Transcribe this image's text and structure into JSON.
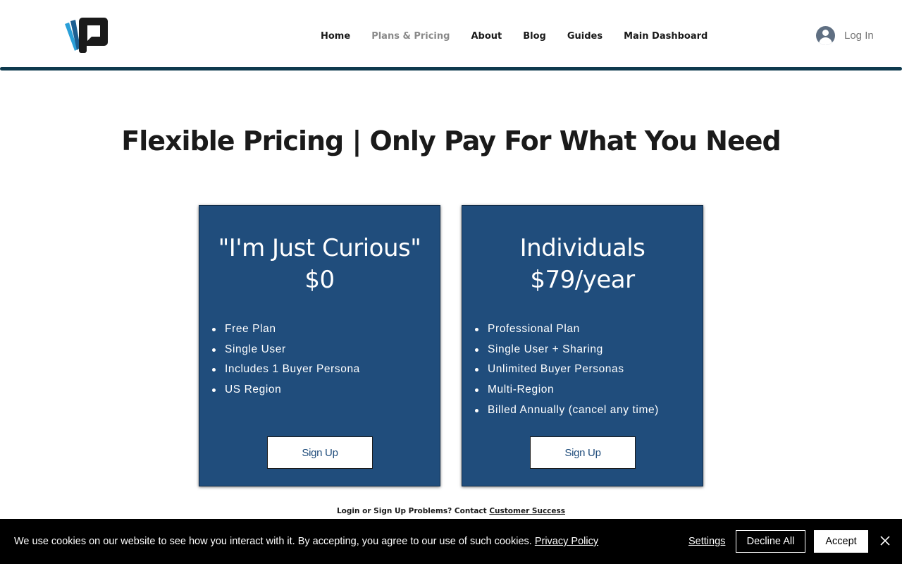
{
  "header": {
    "logo_icon": "brand-logo-icon",
    "nav": [
      {
        "label": "Home",
        "active": false
      },
      {
        "label": "Plans & Pricing",
        "active": true
      },
      {
        "label": "About",
        "active": false
      },
      {
        "label": "Blog",
        "active": false
      },
      {
        "label": "Guides",
        "active": false
      },
      {
        "label": "Main Dashboard",
        "active": false
      }
    ],
    "login_label": "Log In",
    "rule_color": "#0e3a4e"
  },
  "main": {
    "headline": "Flexible Pricing | Only Pay For What You Need",
    "card_color": "#204d7c",
    "plans": [
      {
        "title_line1": "\"I'm Just Curious\"",
        "title_line2": "$0",
        "features": [
          "Free Plan",
          "Single User",
          "Includes 1 Buyer Persona",
          "US Region"
        ],
        "cta_label": "Sign Up"
      },
      {
        "title_line1": "Individuals",
        "title_line2": "$79/year",
        "features": [
          "Professional Plan",
          "Single User + Sharing",
          "Unlimited Buyer Personas",
          "Multi-Region",
          "Billed Annually (cancel any time)"
        ],
        "cta_label": "Sign Up"
      }
    ],
    "help_text": "Login or Sign Up Problems? Contact ",
    "help_link": "Customer Success"
  },
  "cookie_banner": {
    "message": "We use cookies on our website to see how you interact with it. By accepting, you agree to our use of such cookies. ",
    "policy_link": "Privacy Policy",
    "settings_label": "Settings",
    "decline_label": "Decline All",
    "accept_label": "Accept",
    "close_icon": "close-icon"
  }
}
